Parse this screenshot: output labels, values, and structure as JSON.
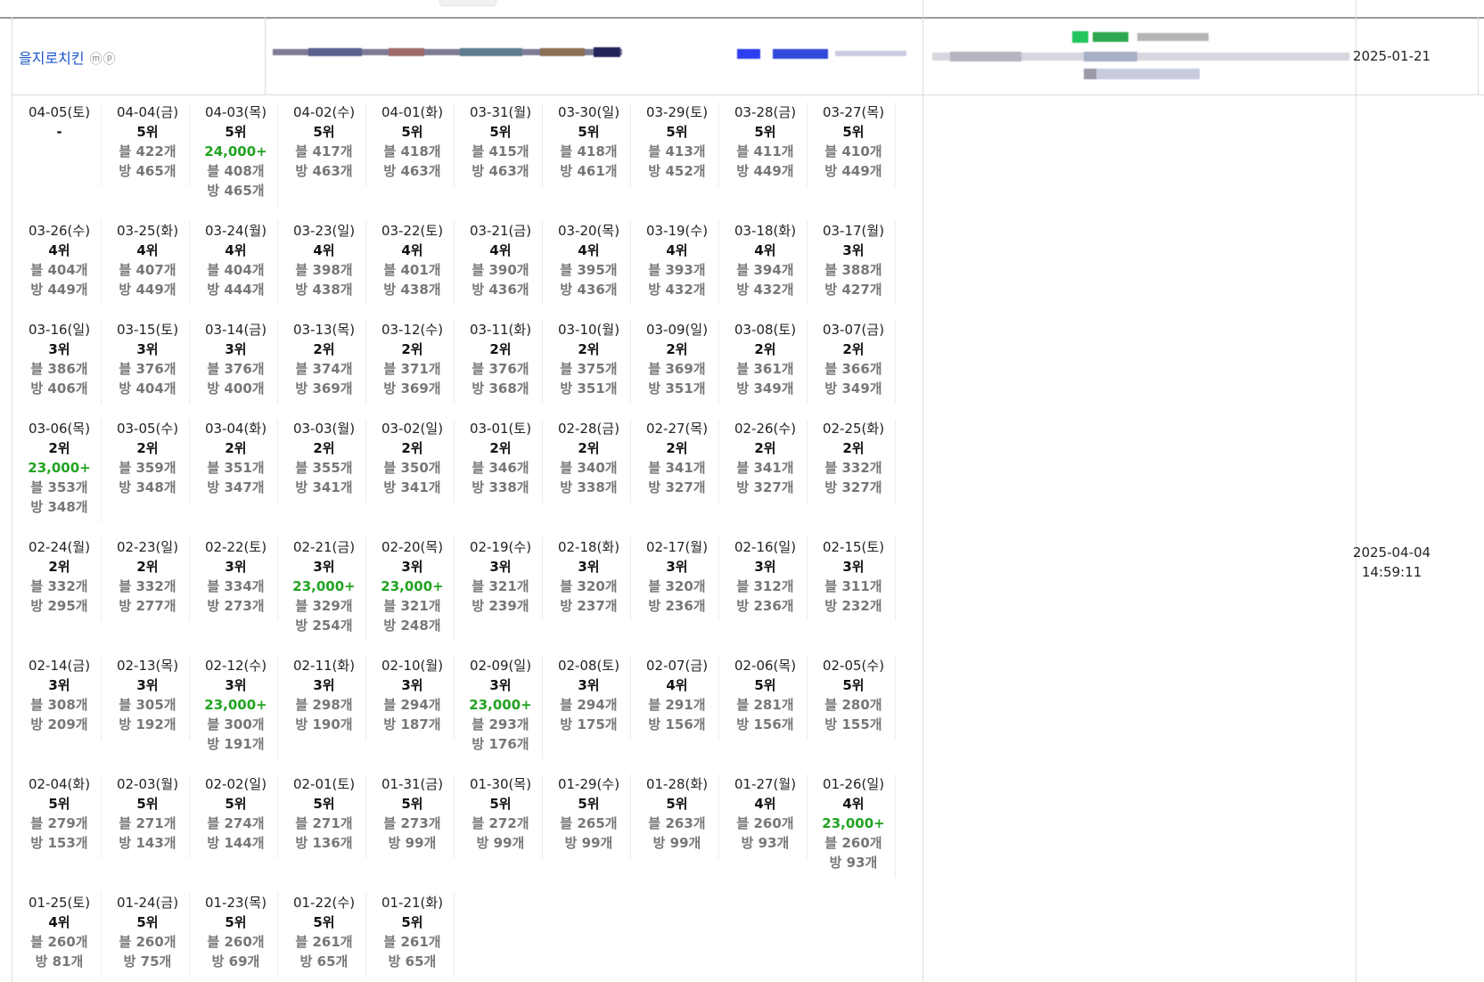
{
  "store": {
    "name": "을지로치킨",
    "badge": "ⓜⓟ"
  },
  "registered_date": "2025-01-21",
  "last_updated": {
    "date": "2025-04-04",
    "time": "14:59:11"
  },
  "colors": {
    "link": "#1a55c8",
    "green": "#22a322",
    "muted": "#777777",
    "border": "#dddddd"
  },
  "history": [
    {
      "date": "04-05(토)",
      "rank": "-",
      "extra": "",
      "blog": "",
      "visit": ""
    },
    {
      "date": "04-04(금)",
      "rank": "5위",
      "extra": "",
      "blog": "블 422개",
      "visit": "방 465개"
    },
    {
      "date": "04-03(목)",
      "rank": "5위",
      "extra": "24,000+",
      "blog": "블 408개",
      "visit": "방 465개"
    },
    {
      "date": "04-02(수)",
      "rank": "5위",
      "extra": "",
      "blog": "블 417개",
      "visit": "방 463개"
    },
    {
      "date": "04-01(화)",
      "rank": "5위",
      "extra": "",
      "blog": "블 418개",
      "visit": "방 463개"
    },
    {
      "date": "03-31(월)",
      "rank": "5위",
      "extra": "",
      "blog": "블 415개",
      "visit": "방 463개"
    },
    {
      "date": "03-30(일)",
      "rank": "5위",
      "extra": "",
      "blog": "블 418개",
      "visit": "방 461개"
    },
    {
      "date": "03-29(토)",
      "rank": "5위",
      "extra": "",
      "blog": "블 413개",
      "visit": "방 452개"
    },
    {
      "date": "03-28(금)",
      "rank": "5위",
      "extra": "",
      "blog": "블 411개",
      "visit": "방 449개"
    },
    {
      "date": "03-27(목)",
      "rank": "5위",
      "extra": "",
      "blog": "블 410개",
      "visit": "방 449개"
    },
    {
      "date": "03-26(수)",
      "rank": "4위",
      "extra": "",
      "blog": "블 404개",
      "visit": "방 449개"
    },
    {
      "date": "03-25(화)",
      "rank": "4위",
      "extra": "",
      "blog": "블 407개",
      "visit": "방 449개"
    },
    {
      "date": "03-24(월)",
      "rank": "4위",
      "extra": "",
      "blog": "블 404개",
      "visit": "방 444개"
    },
    {
      "date": "03-23(일)",
      "rank": "4위",
      "extra": "",
      "blog": "블 398개",
      "visit": "방 438개"
    },
    {
      "date": "03-22(토)",
      "rank": "4위",
      "extra": "",
      "blog": "블 401개",
      "visit": "방 438개"
    },
    {
      "date": "03-21(금)",
      "rank": "4위",
      "extra": "",
      "blog": "블 390개",
      "visit": "방 436개"
    },
    {
      "date": "03-20(목)",
      "rank": "4위",
      "extra": "",
      "blog": "블 395개",
      "visit": "방 436개"
    },
    {
      "date": "03-19(수)",
      "rank": "4위",
      "extra": "",
      "blog": "블 393개",
      "visit": "방 432개"
    },
    {
      "date": "03-18(화)",
      "rank": "4위",
      "extra": "",
      "blog": "블 394개",
      "visit": "방 432개"
    },
    {
      "date": "03-17(월)",
      "rank": "3위",
      "extra": "",
      "blog": "블 388개",
      "visit": "방 427개"
    },
    {
      "date": "03-16(일)",
      "rank": "3위",
      "extra": "",
      "blog": "블 386개",
      "visit": "방 406개"
    },
    {
      "date": "03-15(토)",
      "rank": "3위",
      "extra": "",
      "blog": "블 376개",
      "visit": "방 404개"
    },
    {
      "date": "03-14(금)",
      "rank": "3위",
      "extra": "",
      "blog": "블 376개",
      "visit": "방 400개"
    },
    {
      "date": "03-13(목)",
      "rank": "2위",
      "extra": "",
      "blog": "블 374개",
      "visit": "방 369개"
    },
    {
      "date": "03-12(수)",
      "rank": "2위",
      "extra": "",
      "blog": "블 371개",
      "visit": "방 369개"
    },
    {
      "date": "03-11(화)",
      "rank": "2위",
      "extra": "",
      "blog": "블 376개",
      "visit": "방 368개"
    },
    {
      "date": "03-10(월)",
      "rank": "2위",
      "extra": "",
      "blog": "블 375개",
      "visit": "방 351개"
    },
    {
      "date": "03-09(일)",
      "rank": "2위",
      "extra": "",
      "blog": "블 369개",
      "visit": "방 351개"
    },
    {
      "date": "03-08(토)",
      "rank": "2위",
      "extra": "",
      "blog": "블 361개",
      "visit": "방 349개"
    },
    {
      "date": "03-07(금)",
      "rank": "2위",
      "extra": "",
      "blog": "블 366개",
      "visit": "방 349개"
    },
    {
      "date": "03-06(목)",
      "rank": "2위",
      "extra": "23,000+",
      "blog": "블 353개",
      "visit": "방 348개"
    },
    {
      "date": "03-05(수)",
      "rank": "2위",
      "extra": "",
      "blog": "블 359개",
      "visit": "방 348개"
    },
    {
      "date": "03-04(화)",
      "rank": "2위",
      "extra": "",
      "blog": "블 351개",
      "visit": "방 347개"
    },
    {
      "date": "03-03(월)",
      "rank": "2위",
      "extra": "",
      "blog": "블 355개",
      "visit": "방 341개"
    },
    {
      "date": "03-02(일)",
      "rank": "2위",
      "extra": "",
      "blog": "블 350개",
      "visit": "방 341개"
    },
    {
      "date": "03-01(토)",
      "rank": "2위",
      "extra": "",
      "blog": "블 346개",
      "visit": "방 338개"
    },
    {
      "date": "02-28(금)",
      "rank": "2위",
      "extra": "",
      "blog": "블 340개",
      "visit": "방 338개"
    },
    {
      "date": "02-27(목)",
      "rank": "2위",
      "extra": "",
      "blog": "블 341개",
      "visit": "방 327개"
    },
    {
      "date": "02-26(수)",
      "rank": "2위",
      "extra": "",
      "blog": "블 341개",
      "visit": "방 327개"
    },
    {
      "date": "02-25(화)",
      "rank": "2위",
      "extra": "",
      "blog": "블 332개",
      "visit": "방 327개"
    },
    {
      "date": "02-24(월)",
      "rank": "2위",
      "extra": "",
      "blog": "블 332개",
      "visit": "방 295개"
    },
    {
      "date": "02-23(일)",
      "rank": "2위",
      "extra": "",
      "blog": "블 332개",
      "visit": "방 277개"
    },
    {
      "date": "02-22(토)",
      "rank": "3위",
      "extra": "",
      "blog": "블 334개",
      "visit": "방 273개"
    },
    {
      "date": "02-21(금)",
      "rank": "3위",
      "extra": "23,000+",
      "blog": "블 329개",
      "visit": "방 254개"
    },
    {
      "date": "02-20(목)",
      "rank": "3위",
      "extra": "23,000+",
      "blog": "블 321개",
      "visit": "방 248개"
    },
    {
      "date": "02-19(수)",
      "rank": "3위",
      "extra": "",
      "blog": "블 321개",
      "visit": "방 239개"
    },
    {
      "date": "02-18(화)",
      "rank": "3위",
      "extra": "",
      "blog": "블 320개",
      "visit": "방 237개"
    },
    {
      "date": "02-17(월)",
      "rank": "3위",
      "extra": "",
      "blog": "블 320개",
      "visit": "방 236개"
    },
    {
      "date": "02-16(일)",
      "rank": "3위",
      "extra": "",
      "blog": "블 312개",
      "visit": "방 236개"
    },
    {
      "date": "02-15(토)",
      "rank": "3위",
      "extra": "",
      "blog": "블 311개",
      "visit": "방 232개"
    },
    {
      "date": "02-14(금)",
      "rank": "3위",
      "extra": "",
      "blog": "블 308개",
      "visit": "방 209개"
    },
    {
      "date": "02-13(목)",
      "rank": "3위",
      "extra": "",
      "blog": "블 305개",
      "visit": "방 192개"
    },
    {
      "date": "02-12(수)",
      "rank": "3위",
      "extra": "23,000+",
      "blog": "블 300개",
      "visit": "방 191개"
    },
    {
      "date": "02-11(화)",
      "rank": "3위",
      "extra": "",
      "blog": "블 298개",
      "visit": "방 190개"
    },
    {
      "date": "02-10(월)",
      "rank": "3위",
      "extra": "",
      "blog": "블 294개",
      "visit": "방 187개"
    },
    {
      "date": "02-09(일)",
      "rank": "3위",
      "extra": "23,000+",
      "blog": "블 293개",
      "visit": "방 176개"
    },
    {
      "date": "02-08(토)",
      "rank": "3위",
      "extra": "",
      "blog": "블 294개",
      "visit": "방 175개"
    },
    {
      "date": "02-07(금)",
      "rank": "4위",
      "extra": "",
      "blog": "블 291개",
      "visit": "방 156개"
    },
    {
      "date": "02-06(목)",
      "rank": "5위",
      "extra": "",
      "blog": "블 281개",
      "visit": "방 156개"
    },
    {
      "date": "02-05(수)",
      "rank": "5위",
      "extra": "",
      "blog": "블 280개",
      "visit": "방 155개"
    },
    {
      "date": "02-04(화)",
      "rank": "5위",
      "extra": "",
      "blog": "블 279개",
      "visit": "방 153개"
    },
    {
      "date": "02-03(월)",
      "rank": "5위",
      "extra": "",
      "blog": "블 271개",
      "visit": "방 143개"
    },
    {
      "date": "02-02(일)",
      "rank": "5위",
      "extra": "",
      "blog": "블 274개",
      "visit": "방 144개"
    },
    {
      "date": "02-01(토)",
      "rank": "5위",
      "extra": "",
      "blog": "블 271개",
      "visit": "방 136개"
    },
    {
      "date": "01-31(금)",
      "rank": "5위",
      "extra": "",
      "blog": "블 273개",
      "visit": "방 99개"
    },
    {
      "date": "01-30(목)",
      "rank": "5위",
      "extra": "",
      "blog": "블 272개",
      "visit": "방 99개"
    },
    {
      "date": "01-29(수)",
      "rank": "5위",
      "extra": "",
      "blog": "블 265개",
      "visit": "방 99개"
    },
    {
      "date": "01-28(화)",
      "rank": "5위",
      "extra": "",
      "blog": "블 263개",
      "visit": "방 99개"
    },
    {
      "date": "01-27(월)",
      "rank": "4위",
      "extra": "",
      "blog": "블 260개",
      "visit": "방 93개"
    },
    {
      "date": "01-26(일)",
      "rank": "4위",
      "extra": "23,000+",
      "blog": "블 260개",
      "visit": "방 93개"
    },
    {
      "date": "01-25(토)",
      "rank": "4위",
      "extra": "",
      "blog": "블 260개",
      "visit": "방 81개"
    },
    {
      "date": "01-24(금)",
      "rank": "5위",
      "extra": "",
      "blog": "블 260개",
      "visit": "방 75개"
    },
    {
      "date": "01-23(목)",
      "rank": "5위",
      "extra": "",
      "blog": "블 260개",
      "visit": "방 69개"
    },
    {
      "date": "01-22(수)",
      "rank": "5위",
      "extra": "",
      "blog": "블 261개",
      "visit": "방 65개"
    },
    {
      "date": "01-21(화)",
      "rank": "5위",
      "extra": "",
      "blog": "블 261개",
      "visit": "방 65개"
    }
  ]
}
